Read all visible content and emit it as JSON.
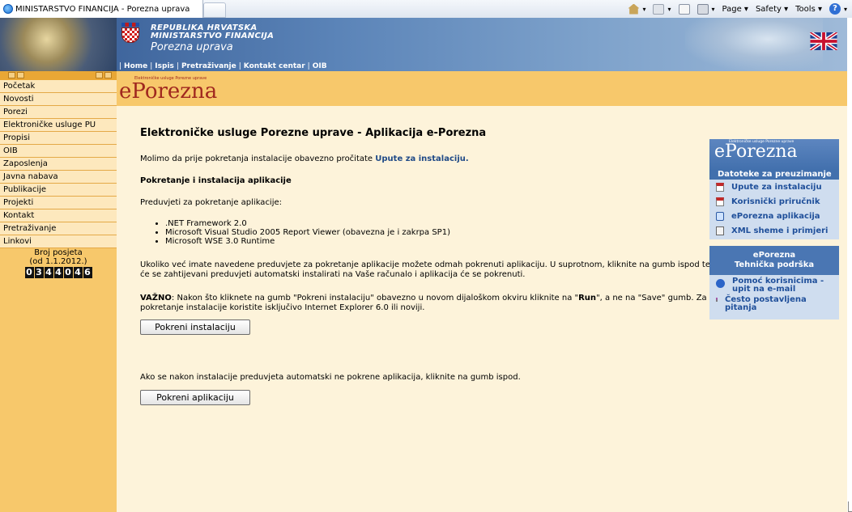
{
  "browser": {
    "tab_title": "MINISTARSTVO FINANCIJA - Porezna uprava",
    "menus": {
      "page": "Page",
      "safety": "Safety",
      "tools": "Tools"
    }
  },
  "header": {
    "line1": "REPUBLIKA HRVATSKA",
    "line2": "MINISTARSTVO FINANCIJA",
    "line3": "Porezna uprava",
    "nav": [
      "Home",
      "Ispis",
      "Pretraživanje",
      "Kontakt centar",
      "OIB"
    ]
  },
  "sidebar": {
    "items": [
      {
        "label": "Početak"
      },
      {
        "label": "Novosti"
      },
      {
        "label": "Porezi"
      },
      {
        "label": "Elektroničke usluge PU"
      },
      {
        "label": "Propisi"
      },
      {
        "label": "OIB"
      },
      {
        "label": "Zaposlenja"
      },
      {
        "label": "Javna nabava"
      },
      {
        "label": "Publikacije"
      },
      {
        "label": "Projekti"
      },
      {
        "label": "Kontakt"
      },
      {
        "label": "Pretraživanje"
      },
      {
        "label": "Linkovi"
      }
    ],
    "visits_label": "Broj posjeta",
    "visits_since": "(od 1.1.2012.)",
    "counter_digits": [
      "0",
      "3",
      "4",
      "4",
      "0",
      "4",
      "6"
    ]
  },
  "logo": {
    "e": "e",
    "word": "Porezna",
    "tagline": "Elektroničke usluge Porezne uprave"
  },
  "main": {
    "title": "Elektroničke usluge Porezne uprave - Aplikacija e-Porezna",
    "intro_text": "Molimo da prije pokretanja instalacije obavezno pročitate ",
    "intro_link": "Upute za instalaciju.",
    "section_title": "Pokretanje i instalacija aplikacije",
    "prereq_intro": "Preduvjeti za pokretanje aplikacije:",
    "prereqs": [
      ".NET Framework 2.0",
      "Microsoft Visual Studio 2005 Report Viewer (obavezna je i zakrpa SP1)",
      "Microsoft WSE 3.0 Runtime"
    ],
    "para1_line1": "Ukoliko već imate navedene preduvjete za pokretanje aplikacije možete odmah pokrenuti aplikaciju. U suprotnom, kliknite na gumb ispod te",
    "para1_line2": "će se zahtijevani preduvjeti automatski instalirati na Vaše računalo i aplikacija će se pokrenuti.",
    "important_label": "VAŽNO",
    "important_a": ": Nakon što kliknete na gumb \"Pokreni instalaciju\" obavezno u novom dijaloškom okviru kliknite na \"",
    "important_run": "Run",
    "important_b": "\", a ne na \"Save\" gumb. Za",
    "important_line2": "pokretanje instalacije koristite isključivo Internet Explorer 6.0 ili noviji.",
    "install_button": "Pokreni instalaciju",
    "fallback_text": "Ako se nakon instalacije preduvjeta automatski ne pokrene aplikacija, kliknite na gumb ispod.",
    "run_button": "Pokreni aplikaciju"
  },
  "downloads": {
    "logo_e": "e",
    "logo_word": "Porezna",
    "logo_tagline": "Elektroničke usluge Porezne uprave",
    "title": "Datoteke za preuzimanje",
    "items": [
      {
        "label": "Upute za instalaciju",
        "icon": "pdf-icon"
      },
      {
        "label": "Korisnički priručnik",
        "icon": "pdf-icon"
      },
      {
        "label": "ePorezna aplikacija",
        "icon": "ie-icon"
      },
      {
        "label": "XML sheme i primjeri",
        "icon": "xml-icon"
      }
    ]
  },
  "support": {
    "title_line1": "ePorezna",
    "title_line2": "Tehnička podrška",
    "items": [
      {
        "line1": "Pomoć korisnicima -",
        "line2": "upit na e-mail",
        "icon": "email-at-icon"
      },
      {
        "line1": "Često postavljena",
        "line2": "pitanja",
        "icon": "faq-icon"
      }
    ]
  },
  "colors": {
    "sidebar_bg": "#f7c86b",
    "content_bg": "#fdf3da",
    "banner_blue": "#31568f",
    "logo_red": "#a0281f",
    "link_blue": "#1f4f9a"
  }
}
